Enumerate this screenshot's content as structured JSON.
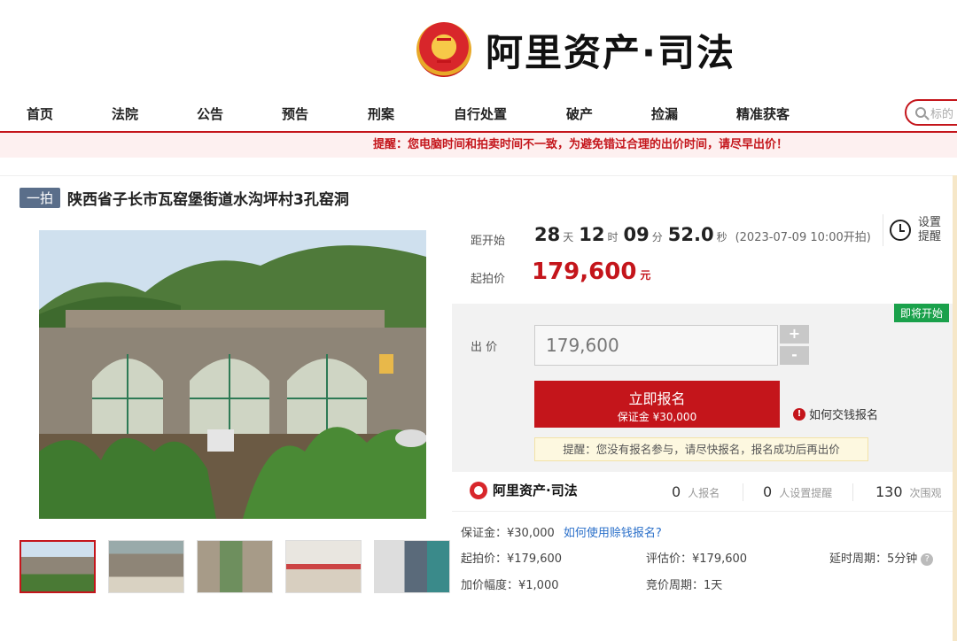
{
  "brand": {
    "title": "阿里资产·司法"
  },
  "nav": {
    "items": [
      "首页",
      "法院",
      "公告",
      "预告",
      "刑案",
      "自行处置",
      "破产",
      "捡漏",
      "精准获客"
    ]
  },
  "search": {
    "placeholder": "标的"
  },
  "notice": "提醒：您电脑时间和拍卖时间不一致，为避免错过合理的出价时间，请尽早出价！",
  "item": {
    "badge": "一拍",
    "title": "陕西省子长市瓦窑堡街道水沟坪村3孔窑洞"
  },
  "countdown": {
    "label": "距开始",
    "days": "28",
    "days_unit": "天",
    "hours": "12",
    "hours_unit": "时",
    "minutes": "09",
    "minutes_unit": "分",
    "seconds": "52.0",
    "seconds_unit": "秒",
    "start_time": "(2023-07-09 10:00开拍)"
  },
  "remind": {
    "text": "设置提醒"
  },
  "price": {
    "label": "起拍价",
    "value": "179,600",
    "unit": "元"
  },
  "status_tag": "即将开始",
  "bid": {
    "label": "出 价",
    "value": "179,600",
    "plus": "+",
    "minus": "-",
    "signup_label": "立即报名",
    "deposit_label": "保证金 ¥30,000",
    "howpay": "如何交钱报名",
    "tip": "提醒：您没有报名参与，请尽快报名，报名成功后再出价"
  },
  "stats": {
    "logo_text": "阿里资产·司法",
    "signups": "0",
    "signups_label": "人报名",
    "reminders": "0",
    "reminders_label": "人设置提醒",
    "views": "130",
    "views_label": "次围观"
  },
  "details": {
    "deposit": "保证金：¥30,000",
    "deposit_link": "如何使用赊钱报名?",
    "start_price": "起拍价：¥179,600",
    "appraisal": "评估价：¥179,600",
    "delay": "延时周期：5分钟",
    "increment": "加价幅度：¥1,000",
    "cycle": "竞价周期：1天"
  },
  "colors": {
    "accent": "#c4151b",
    "status_green": "#1aa14b",
    "badge": "#5a6e8a"
  }
}
